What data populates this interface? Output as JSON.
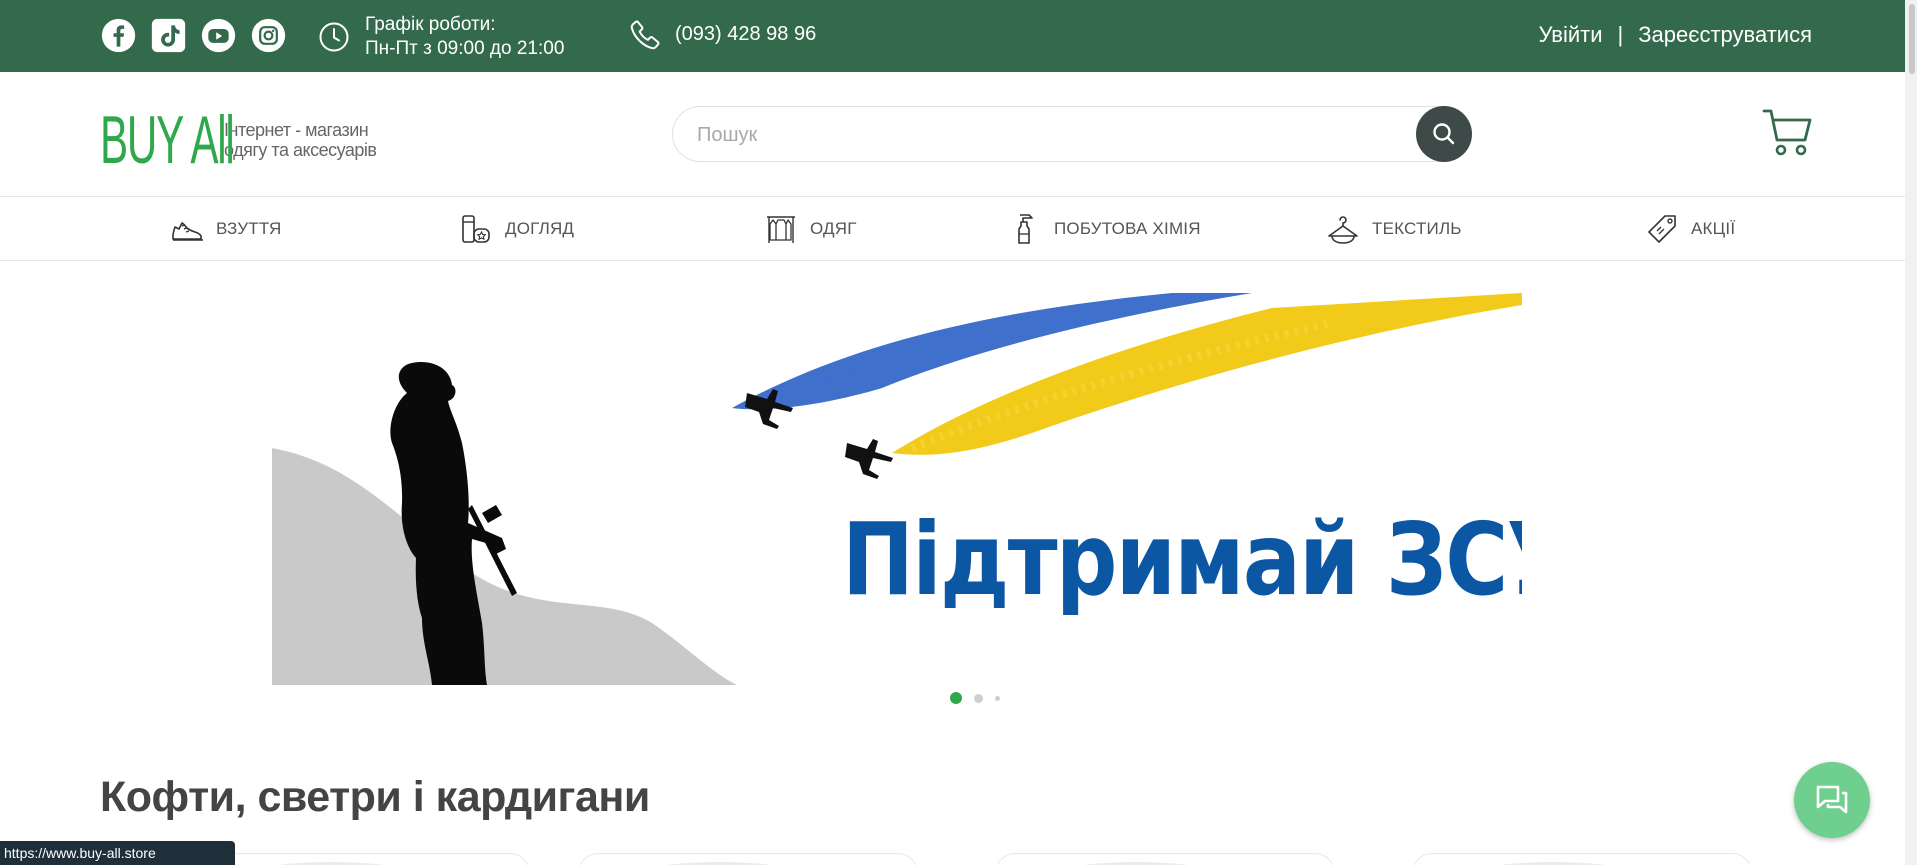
{
  "topbar": {
    "socials": [
      {
        "name": "facebook",
        "icon": "facebook-icon"
      },
      {
        "name": "tiktok",
        "icon": "tiktok-icon"
      },
      {
        "name": "youtube",
        "icon": "youtube-icon"
      },
      {
        "name": "instagram",
        "icon": "instagram-icon"
      }
    ],
    "hours_label": "Графік роботи:",
    "hours_value": "Пн-Пт з 09:00 до 21:00",
    "phone": "(093) 428 98 96",
    "login": "Увійти",
    "separator": "|",
    "register": "Зареєструватися",
    "color": "#346a4c"
  },
  "header": {
    "logo_text": "BUY ALL",
    "logo_tagline_1": "Інтернет - магазин",
    "logo_tagline_2": "одягу та аксесуарів",
    "search_placeholder": "Пошук",
    "brand_color": "#2ea84a"
  },
  "categories": [
    {
      "label": "ВЗУТТЯ",
      "icon": "sneaker-icon"
    },
    {
      "label": "ДОГЛЯД",
      "icon": "cosmetics-icon"
    },
    {
      "label": "ОДЯГ",
      "icon": "clothes-rack-icon"
    },
    {
      "label": "ПОБУТОВА ХІМІЯ",
      "icon": "spray-bottle-icon"
    },
    {
      "label": "ТЕКСТИЛЬ",
      "icon": "hanger-icon"
    },
    {
      "label": "АКЦІЇ",
      "icon": "price-tag-icon"
    }
  ],
  "banner": {
    "title": "Підтримай ЗСУ",
    "slides_count": 3,
    "active_slide": 1
  },
  "section": {
    "title": "Кофти, светри і кардигани"
  },
  "status_url": "https://www.buy-all.store",
  "chat": {
    "icon": "chat-icon"
  }
}
